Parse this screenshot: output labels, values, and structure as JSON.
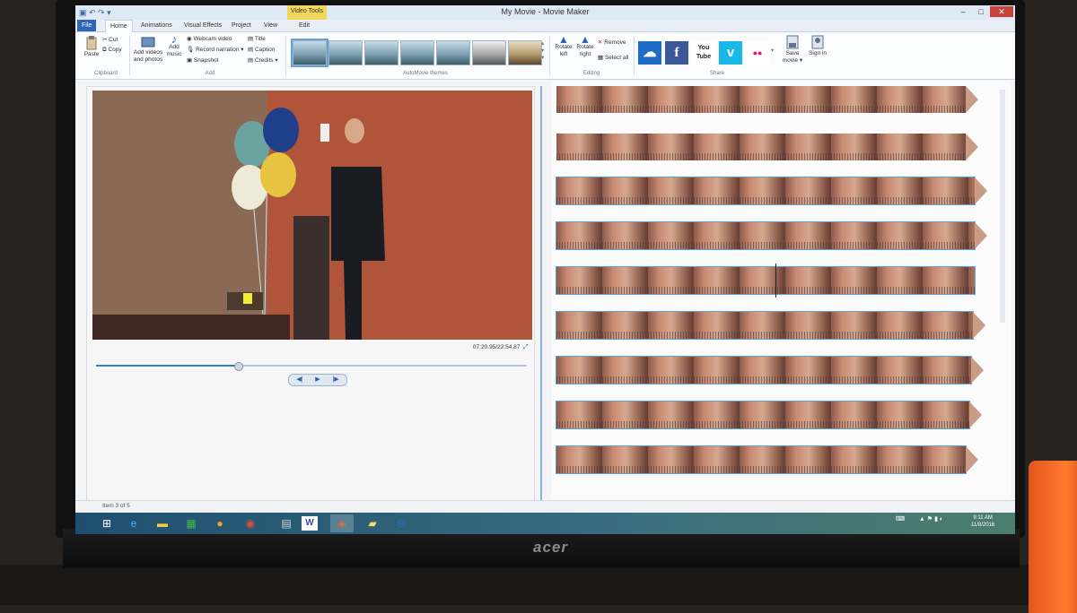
{
  "window": {
    "title": "My Movie - Movie Maker",
    "context_tab": "Video Tools",
    "minimize": "–",
    "maximize": "□",
    "close": "✕"
  },
  "tabs": [
    {
      "label": "File",
      "active": false
    },
    {
      "label": "Home",
      "active": true
    },
    {
      "label": "Animations",
      "active": false
    },
    {
      "label": "Visual Effects",
      "active": false
    },
    {
      "label": "Project",
      "active": false
    },
    {
      "label": "View",
      "active": false
    },
    {
      "label": "Edit",
      "active": false
    }
  ],
  "ribbon": {
    "clipboard": {
      "paste": "Paste",
      "cut": "Cut",
      "copy": "Copy",
      "group": "Clipboard"
    },
    "add": {
      "add_videos": "Add videos and photos",
      "add_music": "Add music",
      "webcam": "Webcam video",
      "record_narration": "Record narration",
      "snapshot": "Snapshot",
      "title": "Title",
      "caption": "Caption",
      "credits": "Credits",
      "group": "Add"
    },
    "themes": {
      "group": "AutoMovie themes",
      "count": 7
    },
    "editing": {
      "rotate_left": "Rotate left",
      "rotate_right": "Rotate right",
      "remove": "Remove",
      "select_all": "Select all",
      "group": "Editing"
    },
    "share": {
      "onedrive": "☁",
      "facebook": "f",
      "youtube": "You Tube",
      "vimeo": "v",
      "flickr": "●●",
      "save_movie": "Save movie",
      "sign_in": "Sign in",
      "group": "Share"
    }
  },
  "player": {
    "time": "07:20.95/22:54.87",
    "progress": 0.33,
    "prev": "◀|",
    "play": "▶",
    "next": "|▶"
  },
  "storyboard": {
    "rows": 9,
    "selected_rows": [
      3,
      4,
      5,
      6,
      7,
      8,
      9
    ]
  },
  "status": {
    "item": "Item 3 of 5"
  },
  "taskbar": {
    "time": "9:11 AM",
    "date": "11/8/2016"
  },
  "monitor": {
    "brand": "acer"
  },
  "colors": {
    "accent": "#2f66b3",
    "context_tab": "#f2d85a",
    "selection": "#5da2e0"
  }
}
